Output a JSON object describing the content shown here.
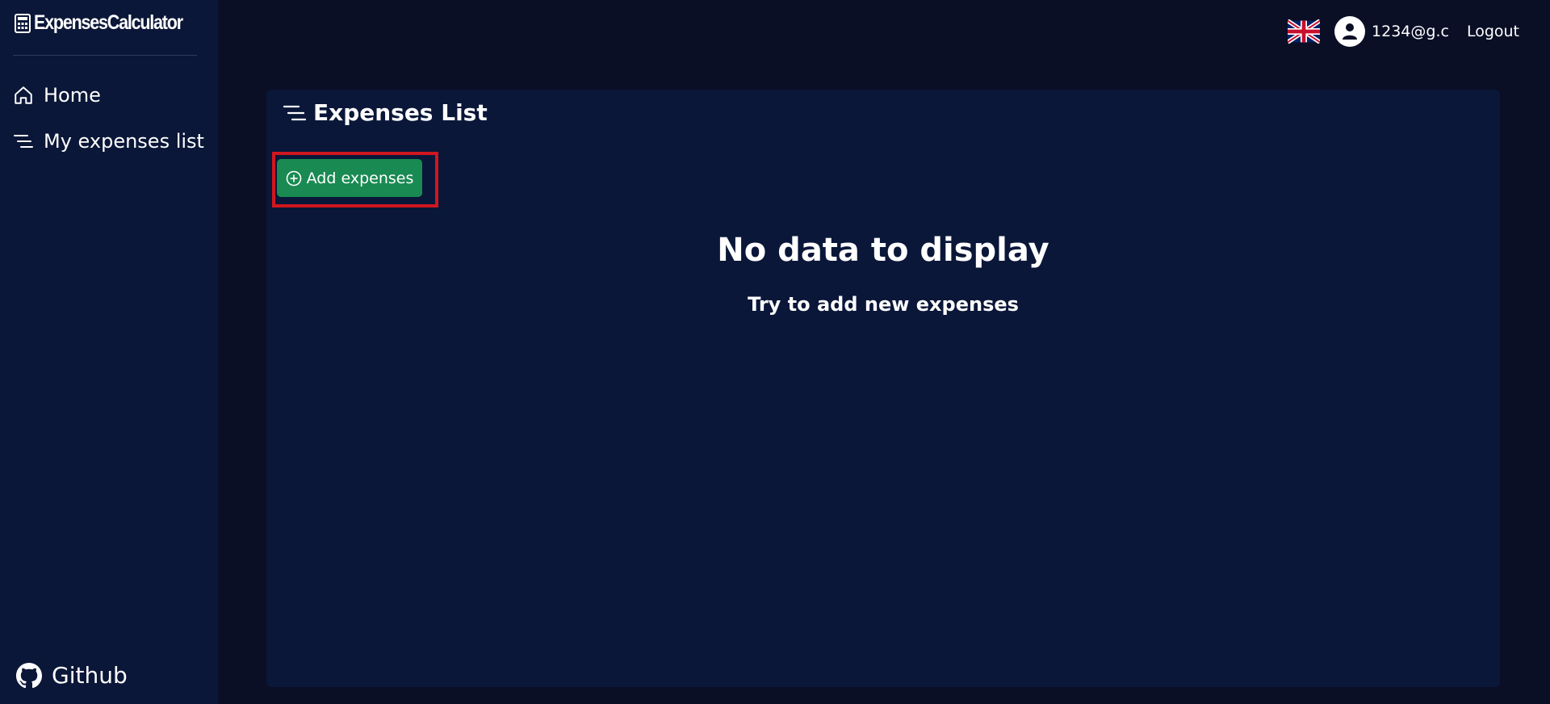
{
  "app": {
    "brand": "ExpensesCalculator"
  },
  "sidebar": {
    "items": [
      {
        "label": "Home",
        "icon": "home-icon"
      },
      {
        "label": "My expenses list",
        "icon": "list-icon"
      }
    ],
    "footer": {
      "label": "Github",
      "icon": "github-icon"
    }
  },
  "header": {
    "language_icon": "uk-flag-icon",
    "user": {
      "email": "1234@g.c",
      "icon": "user-icon"
    },
    "logout_label": "Logout"
  },
  "main": {
    "title": "Expenses List",
    "title_icon": "list-icon",
    "add_button_label": "Add expenses",
    "add_button_icon": "plus-circle-icon",
    "empty_title": "No data to display",
    "empty_subtitle": "Try to add new expenses"
  },
  "colors": {
    "background": "#0a0f26",
    "sidebar": "#0b1738",
    "card": "#0a1739",
    "button_green": "#198a52",
    "highlight_red": "#d0161f"
  }
}
